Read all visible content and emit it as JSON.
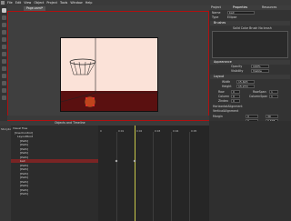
{
  "menu": [
    "File",
    "Edit",
    "View",
    "Object",
    "Project",
    "Tools",
    "Window",
    "Help"
  ],
  "document_tab": "Page.xaml*",
  "right_panel": {
    "tabs": [
      "Project",
      "Properties",
      "Resources"
    ],
    "name_label": "Name",
    "name_value": "ball",
    "type_label": "Type",
    "type_value": "Ellipse",
    "brushes_header": "Brushes",
    "brush_row": "Solid Color Brush  No brush",
    "appearance_header": "Appearance",
    "opacity_label": "Opacity",
    "opacity_value": "100%",
    "visibility_label": "Visibility",
    "visibility_value": "Visible",
    "layout_header": "Layout",
    "width_label": "Width",
    "width_value": "15.645",
    "height_label": "Height",
    "height_value": "15.270",
    "row_label": "Row",
    "row_value": "0",
    "rowspan_label": "RowSpan",
    "rowspan_value": "1",
    "column_label": "Column",
    "column_value": "0",
    "columnspan_label": "ColumnSpan",
    "columnspan_value": "1",
    "zindex_label": "ZIndex",
    "zindex_value": "0",
    "halign_label": "HorizontalAlignment",
    "valign_label": "VerticalAlignment",
    "margin_label": "Margin",
    "margin_values": [
      "0",
      "30",
      "0",
      "0.635"
    ],
    "common_header": "Common Properties",
    "cursor_label": "Cursor",
    "cursor_value": "Default",
    "tooltip_label": "ToolTip",
    "transform_header": "Transform",
    "render_label": "RenderTransform",
    "transform_x": "X  160.046",
    "transform_y": "Y  33.840",
    "misc_header": "Miscellaneous"
  },
  "objects_panel": {
    "tabs": [
      "Objects and Timeline"
    ],
    "left_header": "Storyboard",
    "tree_rows": [
      "Visual Tree",
      "[UserControl]",
      "LayoutRoot",
      "[Path]",
      "[Path]",
      "[Path]",
      "[Path]",
      "[Path]",
      "ball",
      "[Path]",
      "[Path]",
      "[Path]",
      "[Path]",
      "[Path]",
      "[Path]",
      "[Path]",
      "[Path]"
    ],
    "selected_row": "ball",
    "time_ticks": [
      "0",
      "0:01",
      "0:02",
      "0:03",
      "0:04",
      "0:05"
    ]
  }
}
